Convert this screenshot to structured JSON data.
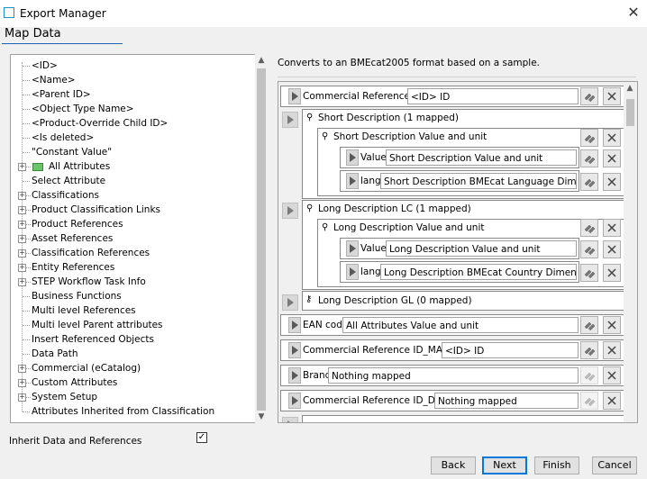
{
  "window": {
    "title": "Export Manager",
    "close_glyph": "✕"
  },
  "section": {
    "title": "Map Data"
  },
  "tree": {
    "items": [
      {
        "label": "<ID>",
        "expandable": false
      },
      {
        "label": "<Name>",
        "expandable": false
      },
      {
        "label": "<Parent ID>",
        "expandable": false
      },
      {
        "label": "<Object Type Name>",
        "expandable": false
      },
      {
        "label": "<Product-Override Child ID>",
        "expandable": false
      },
      {
        "label": "<Is deleted>",
        "expandable": false
      },
      {
        "label": "\"Constant Value\"",
        "expandable": false
      },
      {
        "label": "All Attributes",
        "expandable": true,
        "icon": "folder-icon"
      },
      {
        "label": "Select Attribute",
        "expandable": false
      },
      {
        "label": "Classifications",
        "expandable": true
      },
      {
        "label": "Product Classification Links",
        "expandable": true
      },
      {
        "label": "Product References",
        "expandable": true
      },
      {
        "label": "Asset References",
        "expandable": true
      },
      {
        "label": "Classification References",
        "expandable": true
      },
      {
        "label": "Entity References",
        "expandable": true
      },
      {
        "label": "STEP Workflow Task Info",
        "expandable": true
      },
      {
        "label": "Business Functions",
        "expandable": false
      },
      {
        "label": "Multi level References",
        "expandable": false
      },
      {
        "label": "Multi level Parent attributes",
        "expandable": false
      },
      {
        "label": "Insert Referenced Objects",
        "expandable": false
      },
      {
        "label": "Data Path",
        "expandable": false
      },
      {
        "label": "Commercial (eCatalog)",
        "expandable": true
      },
      {
        "label": "Custom Attributes",
        "expandable": true
      },
      {
        "label": "System Setup",
        "expandable": true
      },
      {
        "label": "Attributes Inherited from Classification",
        "expandable": false
      }
    ]
  },
  "mapping": {
    "description": "Converts to an BMEcat2005 format based on a sample.",
    "rows": {
      "commercial_reference_id": {
        "label": "Commercial Reference ID",
        "value": "<ID> ID"
      },
      "short_description": {
        "label": "Short Description (1 mapped)"
      },
      "short_desc_value_unit": {
        "label": "Short Description Value and unit"
      },
      "short_value": {
        "label": "Value",
        "value": "Short Description Value and unit"
      },
      "short_lang": {
        "label": "lang",
        "value": "Short Description BMEcat Language Dimension"
      },
      "long_description_lc": {
        "label": "Long Description LC (1 mapped)"
      },
      "long_desc_value_unit": {
        "label": "Long Description Value and unit"
      },
      "long_value": {
        "label": "Value",
        "value": "Long Description Value and unit"
      },
      "long_lang": {
        "label": "lang",
        "value": "Long Description BMEcat Country Dimension"
      },
      "long_description_gl": {
        "label": "Long Description GL (0 mapped)"
      },
      "ean_code": {
        "label": "EAN code",
        "value": "All Attributes Value and unit"
      },
      "commercial_reference_id_manuf": {
        "label": "Commercial Reference ID_MANUF",
        "value": "<ID> ID"
      },
      "brand": {
        "label": "Brand",
        "value": "Nothing mapped"
      },
      "commercial_reference_id_desc": {
        "label": "Commercial Reference ID_DESC",
        "value": "Nothing mapped"
      }
    }
  },
  "footer": {
    "inherit_label": "Inherit Data and References",
    "inherit_checked": true,
    "check_glyph": "✓",
    "back": "Back",
    "next": "Next",
    "finish": "Finish",
    "cancel": "Cancel"
  },
  "colors": {
    "accent": "#0078d7",
    "section_underline": "#1e64b4",
    "folder": "#6ac46a"
  }
}
